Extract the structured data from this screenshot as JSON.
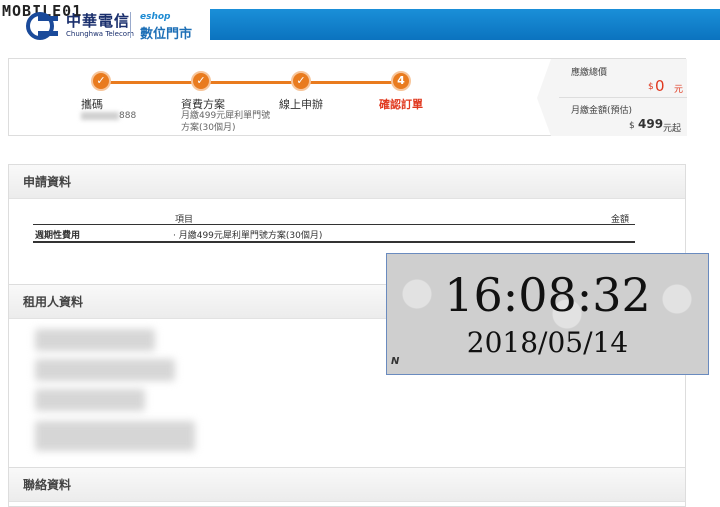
{
  "watermark": "MOBILE01",
  "brand": {
    "name_cn": "中華電信",
    "name_en": "Chunghwa Telecom",
    "eshop_en": "eshop",
    "eshop_cn": "數位門市"
  },
  "colors": {
    "accent": "#e97b1e",
    "brand_blue": "#1a8fd8",
    "price_red": "#e0381e"
  },
  "progress": {
    "steps": [
      {
        "number": "✓",
        "label": "攜碼",
        "sub": "888"
      },
      {
        "number": "✓",
        "label": "資費方案",
        "sub": "月繳499元犀利單門號方案(30個月)"
      },
      {
        "number": "✓",
        "label": "線上申辦",
        "sub": ""
      },
      {
        "number": "4",
        "label": "確認訂單",
        "sub": ""
      }
    ]
  },
  "summary": {
    "total_label": "應繳總價",
    "total_currency": "$",
    "total_value": "0",
    "total_unit": "元",
    "monthly_label": "月繳金額(預估)",
    "monthly_currency": "$",
    "monthly_value": "499",
    "monthly_unit": "元起"
  },
  "sections": {
    "application": {
      "title": "申請資料",
      "columns": [
        "項目",
        "金額"
      ],
      "rows": [
        {
          "type": "週期性費用",
          "item": "· 月繳499元犀利單門號方案(30個月)",
          "amount": ""
        }
      ]
    },
    "renter": {
      "title": "租用人資料"
    },
    "contact": {
      "title": "聯絡資料"
    }
  },
  "clock": {
    "time": "16:08:32",
    "date": "2018/05/14",
    "mark": "N"
  }
}
